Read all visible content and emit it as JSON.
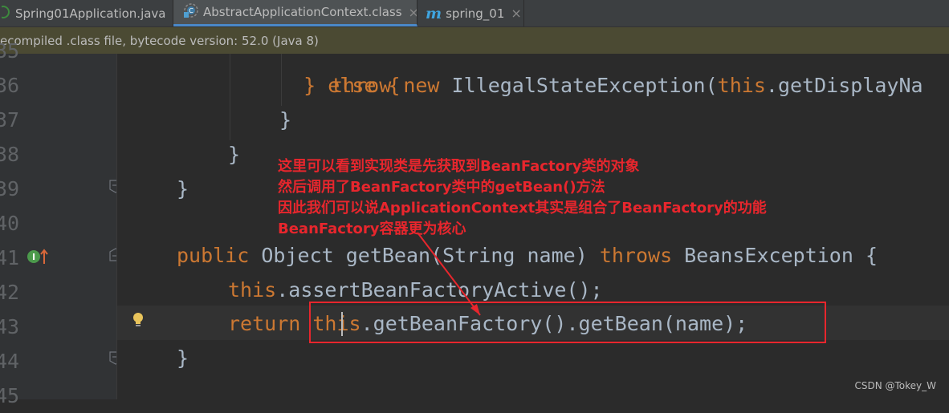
{
  "tabs": [
    {
      "label": "Spring01Application.java",
      "icon": "java-class-icon",
      "active": false
    },
    {
      "label": "AbstractApplicationContext.class",
      "icon": "abstract-class-icon",
      "active": true
    },
    {
      "label": "spring_01",
      "icon": "maven-m-icon",
      "active": false
    }
  ],
  "tab_close_glyph": "×",
  "notice": {
    "text": "ecompiled .class file, bytecode version: 52.0 (Java 8)"
  },
  "line_numbers": [
    "35",
    "36",
    "37",
    "38",
    "39",
    "40",
    "41",
    "42",
    "43",
    "44",
    "45"
  ],
  "code": {
    "l35": {
      "text": "} else {"
    },
    "l36": {
      "kw1": "throw",
      "kw2": "new",
      "rest": " IllegalStateException(",
      "kw3": "this",
      "tail": ".getDisplayNa"
    },
    "l37": {
      "text": "}"
    },
    "l38": {
      "text": "}"
    },
    "l39": {
      "text": "}"
    },
    "l41": {
      "kw1": "public",
      "mid": " Object getBean(String name) ",
      "kw2": "throws",
      "tail": " BeansException {"
    },
    "l42": {
      "kw1": "this",
      "tail": ".assertBeanFactoryActive();"
    },
    "l43": {
      "kw1": "return",
      "kw2": "this",
      "tail": ".getBeanFactory().getBean(name);"
    },
    "l44": {
      "text": "}"
    }
  },
  "annotation": {
    "lines": [
      "这里可以看到实现类是先获取到BeanFactory类的对象",
      "然后调用了BeanFactory类中的getBean()方法",
      "因此我们可以说ApplicationContext其实是组合了BeanFactory的功能",
      "BeanFactory容器更为核心"
    ],
    "color": "#e8262d"
  },
  "watermark": "CSDN @Tokey_W",
  "colors": {
    "keyword": "#cc7832",
    "text": "#a9b7c6",
    "background": "#2b2b2b",
    "gutter": "#313335",
    "annotation": "#e8262d"
  }
}
